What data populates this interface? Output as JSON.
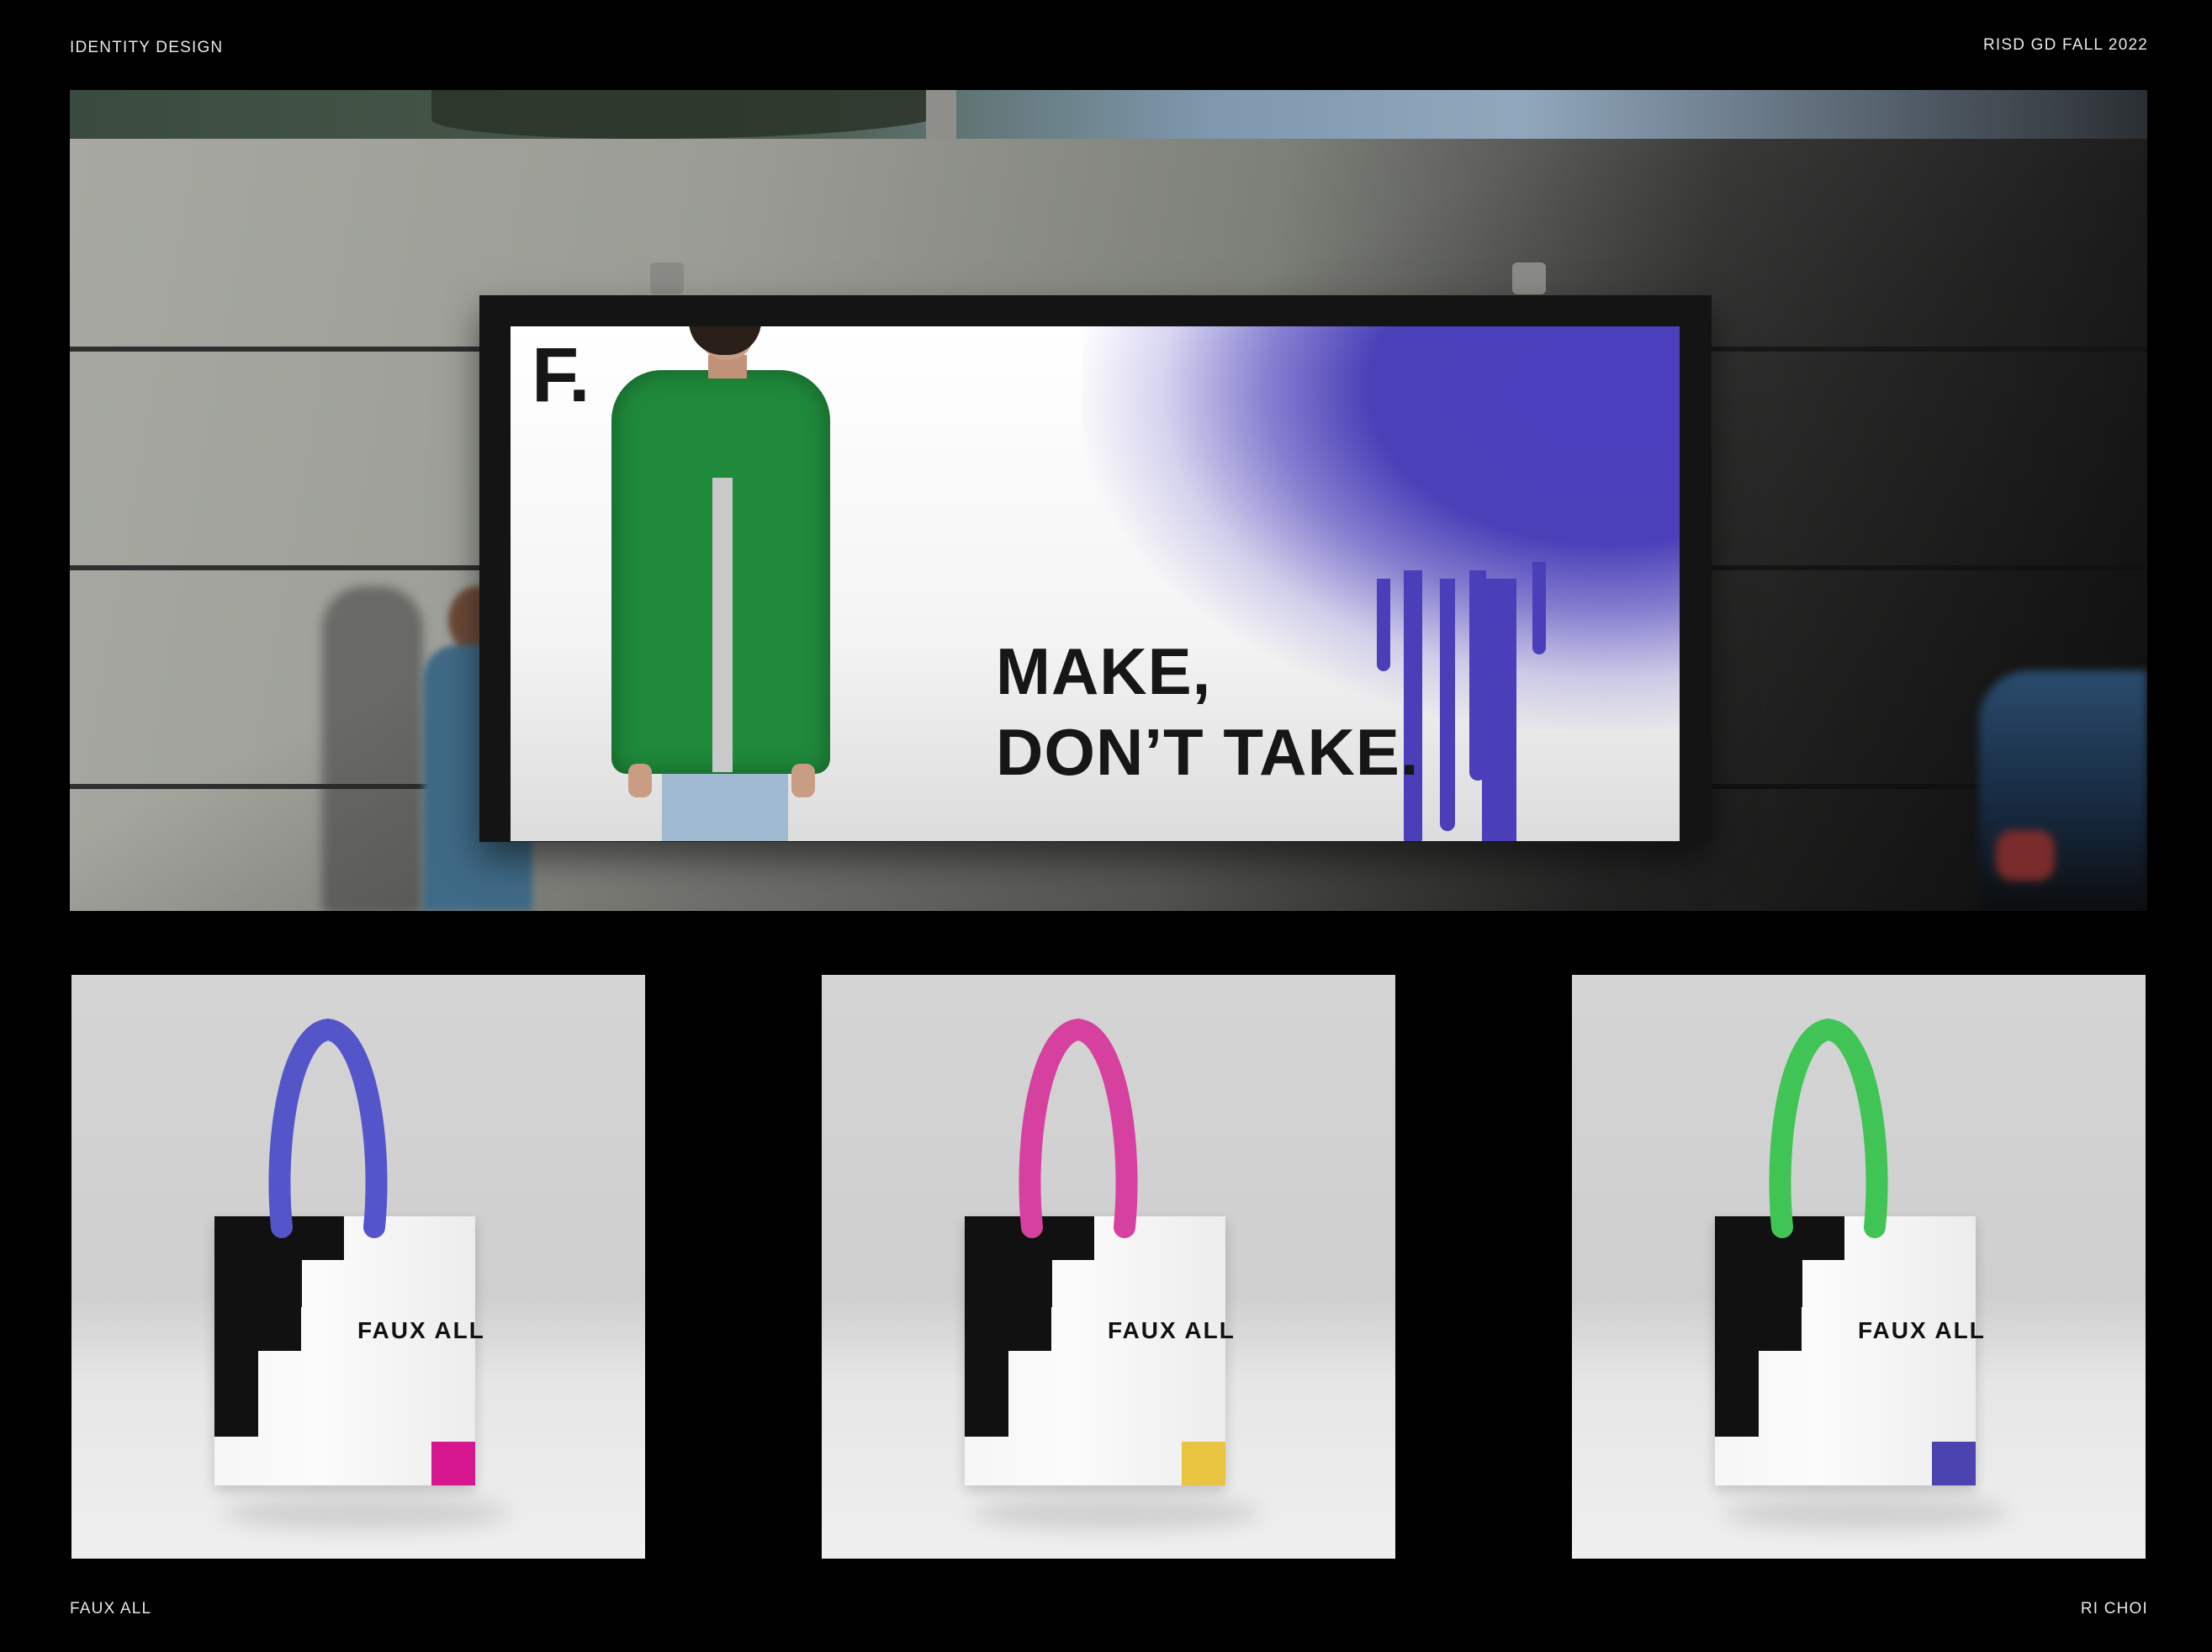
{
  "corners": {
    "top_left": "IDENTITY DESIGN",
    "top_right": "RISD GD FALL 2022",
    "bottom_left": "FAUX ALL",
    "bottom_right": "RI CHOI"
  },
  "billboard": {
    "logo": "F.",
    "headline": "MAKE,\nDON’T TAKE.",
    "spray_color": "#4a3fb8",
    "coat_color": "#1f8a3b"
  },
  "bags": [
    {
      "label": "FAUX ALL",
      "handle_color": "#5355c9",
      "square_color": "#d4168f"
    },
    {
      "label": "FAUX ALL",
      "handle_color": "#d6419f",
      "square_color": "#e9c441"
    },
    {
      "label": "FAUX ALL",
      "handle_color": "#3fc455",
      "square_color": "#4b44b0"
    }
  ]
}
